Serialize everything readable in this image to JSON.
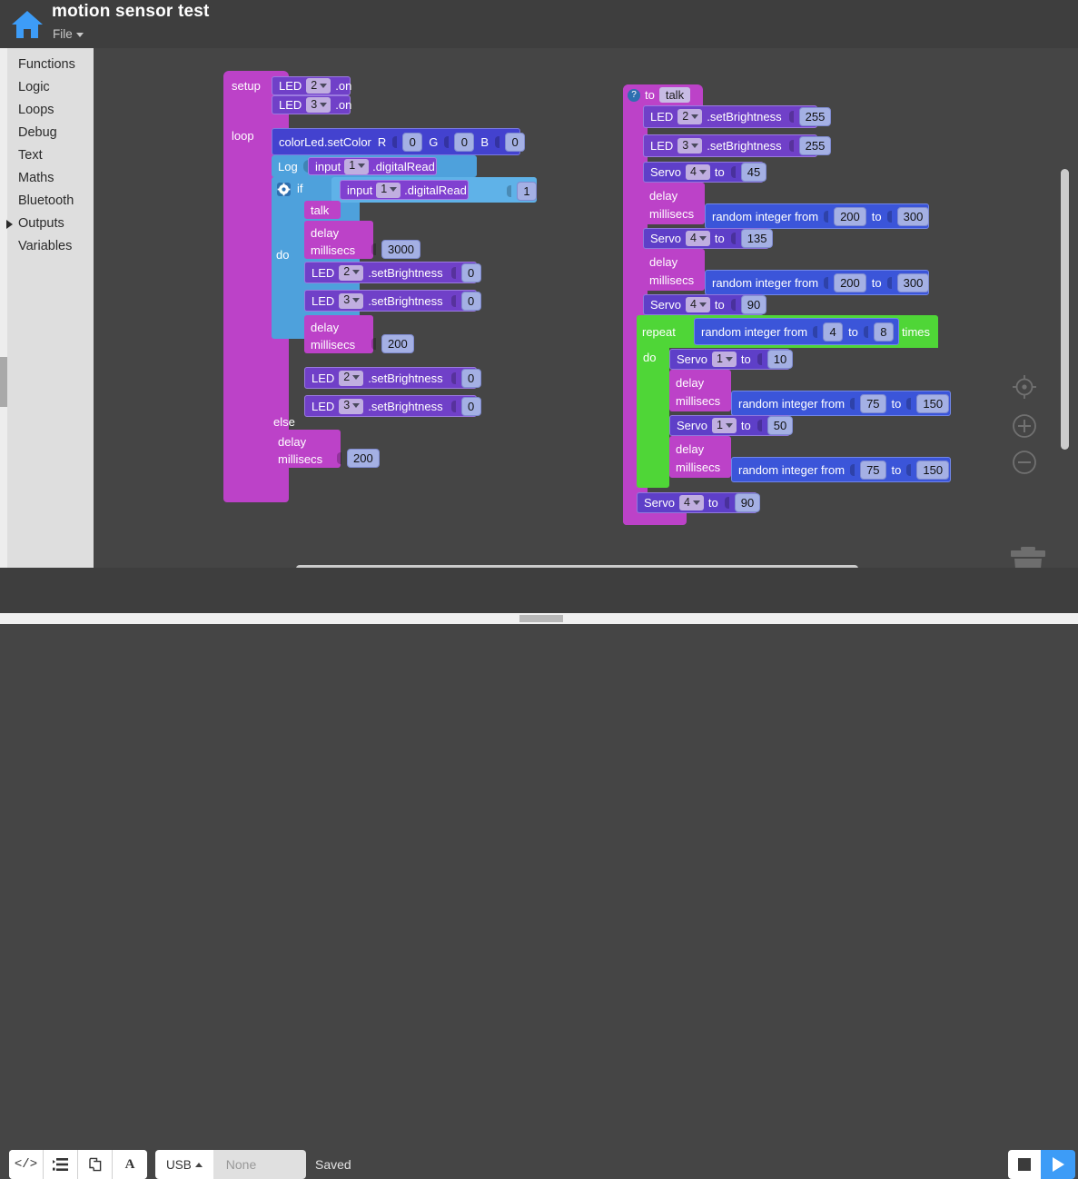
{
  "header": {
    "app_title": "motion sensor test",
    "file_menu": "File",
    "home_icon": "home-icon"
  },
  "sidebar": {
    "items": [
      {
        "label": "Functions",
        "expanded": false
      },
      {
        "label": "Logic",
        "expanded": false
      },
      {
        "label": "Loops",
        "expanded": false
      },
      {
        "label": "Debug",
        "expanded": false
      },
      {
        "label": "Text",
        "expanded": false
      },
      {
        "label": "Maths",
        "expanded": false
      },
      {
        "label": "Bluetooth",
        "expanded": false
      },
      {
        "label": "Outputs",
        "expanded": true
      },
      {
        "label": "Variables",
        "expanded": false
      }
    ]
  },
  "workspace": {
    "colors": {
      "background": "#454545",
      "function_magenta": "#bc42c8",
      "led_purple": "#7040c8",
      "setcolor_blue": "#4342cf",
      "logic_blue": "#4ea1dc",
      "input_purple": "#8040d0",
      "loop_green": "#4fd637",
      "math_blue": "#3b55d9",
      "servo_violet": "#5e3fc8"
    },
    "main_stack": {
      "setup_label": "setup",
      "loop_label": "loop",
      "setup_blocks": [
        {
          "prefix": "LED",
          "pin": "2",
          "suffix": ".on"
        },
        {
          "prefix": "LED",
          "pin": "3",
          "suffix": ".on"
        }
      ],
      "set_color": {
        "label": "colorLed.setColor",
        "r_label": "R",
        "r_value": "0",
        "g_label": "G",
        "g_value": "0",
        "b_label": "B",
        "b_value": "0"
      },
      "log": {
        "label": "Log",
        "input_prefix": "input",
        "input_pin": "1",
        "input_suffix": ".digitalRead"
      },
      "if_block": {
        "gear_icon": "gear-icon",
        "if_label": "if",
        "do_label": "do",
        "else_label": "else",
        "condition": {
          "input_prefix": "input",
          "input_pin": "1",
          "input_suffix": ".digitalRead",
          "operator": "=",
          "compare_value": "1"
        },
        "do_blocks": {
          "talk_label": "talk",
          "delay_label": "delay",
          "millisecs_label": "millisecs",
          "delay_value": "3000",
          "leds": [
            {
              "prefix": "LED",
              "pin": "2",
              "suffix": ".setBrightness",
              "value": "0"
            },
            {
              "prefix": "LED",
              "pin": "3",
              "suffix": ".setBrightness",
              "value": "0"
            }
          ],
          "delay2_label": "delay",
          "millisecs2_label": "millisecs",
          "delay2_value": "200"
        },
        "else_blocks": {
          "leds": [
            {
              "prefix": "LED",
              "pin": "2",
              "suffix": ".setBrightness",
              "value": "0"
            },
            {
              "prefix": "LED",
              "pin": "3",
              "suffix": ".setBrightness",
              "value": "0"
            }
          ]
        }
      },
      "tail_delay": {
        "delay_label": "delay",
        "millisecs_label": "millisecs",
        "value": "200"
      }
    },
    "talk_function": {
      "help_icon": "question-mark-icon",
      "to_label": "to",
      "name": "talk",
      "rows": [
        {
          "kind": "led",
          "prefix": "LED",
          "pin": "2",
          "suffix": ".setBrightness",
          "value": "255"
        },
        {
          "kind": "led",
          "prefix": "LED",
          "pin": "3",
          "suffix": ".setBrightness",
          "value": "255"
        },
        {
          "kind": "servo",
          "prefix": "Servo",
          "pin": "4",
          "to": "to",
          "value": "45"
        },
        {
          "kind": "delay_random",
          "delay_label": "delay",
          "millisecs_label": "millisecs",
          "random_label": "random integer from",
          "from": "200",
          "to_label": "to",
          "to": "300"
        },
        {
          "kind": "servo",
          "prefix": "Servo",
          "pin": "4",
          "to": "to",
          "value": "135"
        },
        {
          "kind": "delay_random",
          "delay_label": "delay",
          "millisecs_label": "millisecs",
          "random_label": "random integer from",
          "from": "200",
          "to_label": "to",
          "to": "300"
        },
        {
          "kind": "servo",
          "prefix": "Servo",
          "pin": "4",
          "to": "to",
          "value": "90"
        }
      ],
      "repeat": {
        "repeat_label": "repeat",
        "times_label": "times",
        "do_label": "do",
        "random_label": "random integer from",
        "from": "4",
        "to_label": "to",
        "to": "8",
        "body": [
          {
            "kind": "servo",
            "prefix": "Servo",
            "pin": "1",
            "to": "to",
            "value": "10"
          },
          {
            "kind": "delay_random",
            "delay_label": "delay",
            "millisecs_label": "millisecs",
            "random_label": "random integer from",
            "from": "75",
            "to_label": "to",
            "to": "150"
          },
          {
            "kind": "servo",
            "prefix": "Servo",
            "pin": "1",
            "to": "to",
            "value": "50"
          },
          {
            "kind": "delay_random",
            "delay_label": "delay",
            "millisecs_label": "millisecs",
            "random_label": "random integer from",
            "from": "75",
            "to_label": "to",
            "to": "150"
          }
        ]
      },
      "final_servo": {
        "prefix": "Servo",
        "pin": "4",
        "to": "to",
        "value": "90"
      }
    },
    "controls": {
      "center_icon": "crosshair-target-icon",
      "zoom_in_icon": "zoom-in-icon",
      "zoom_out_icon": "zoom-out-icon",
      "trash_icon": "trash-icon"
    }
  },
  "bottombar": {
    "tools": [
      {
        "name": "code-view-icon",
        "glyph": "</>"
      },
      {
        "name": "blocks-list-icon",
        "glyph": "list"
      },
      {
        "name": "copy-icon",
        "glyph": "copy"
      },
      {
        "name": "font-icon",
        "glyph": "A"
      }
    ],
    "connection_type": "USB",
    "port_value": "None",
    "port_placeholder": "None",
    "status": "Saved",
    "stop_icon": "stop-icon",
    "play_icon": "play-icon"
  }
}
